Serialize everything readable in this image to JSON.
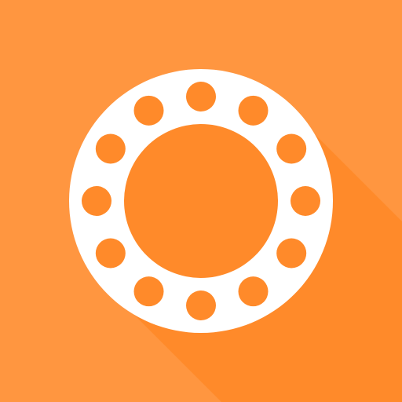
{
  "icon": {
    "name": "dial-ring-icon",
    "dot_count": 12
  },
  "colors": {
    "background": "#ff9640",
    "shadow": "#ff8a2a",
    "ring": "#ffffff",
    "accent": "#ff8a2a"
  }
}
